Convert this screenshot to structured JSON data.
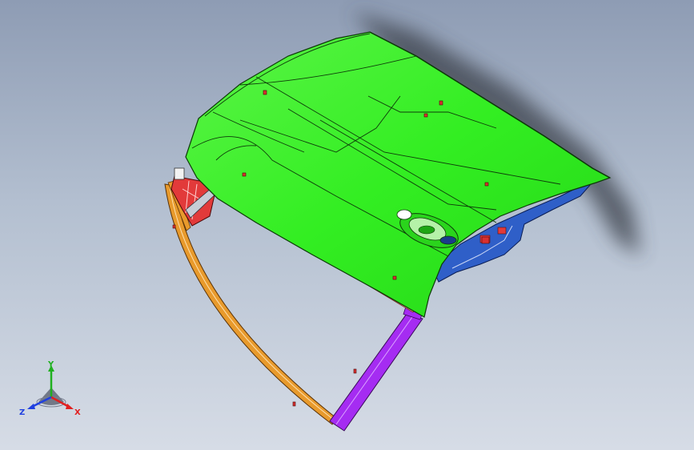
{
  "viewport": {
    "background_top": "#8e9cb4",
    "background_bottom": "#d6dce6"
  },
  "model": {
    "panel_color": "#33ee22",
    "frame_color": "#e89a2c",
    "pillar_color": "#a52cf2",
    "inner_color": "#2f5fc8",
    "hinge_color": "#e23a3a",
    "seal_color": "#f4a49a"
  },
  "triad": {
    "x_label": "X",
    "y_label": "Y",
    "z_label": "Z",
    "x_color": "#e02020",
    "y_color": "#20b020",
    "z_color": "#2040e0"
  }
}
